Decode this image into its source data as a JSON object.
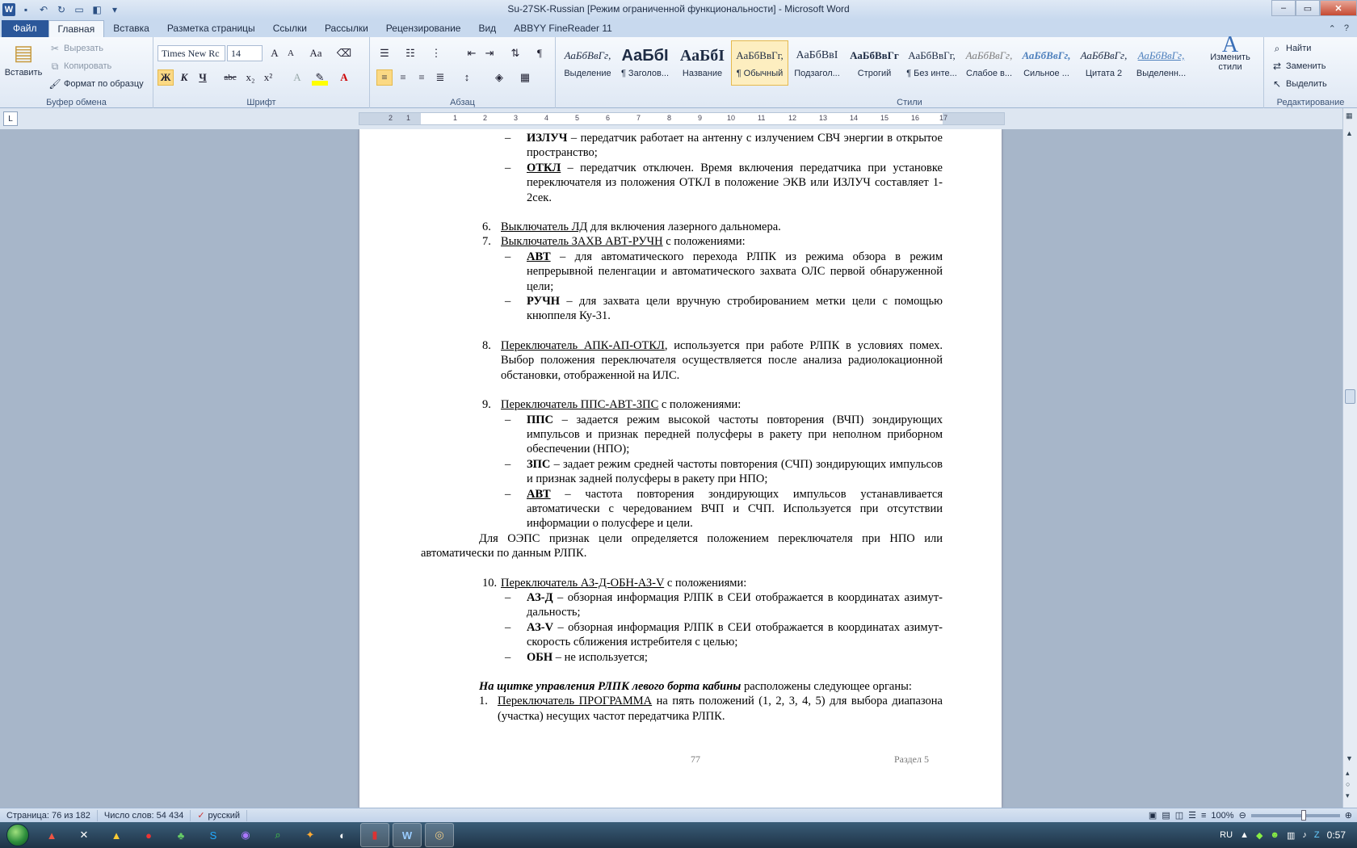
{
  "window": {
    "title": "Su-27SK-Russian [Режим ограниченной функциональности]  -  Microsoft Word"
  },
  "tabs": [
    {
      "label": "Файл"
    },
    {
      "label": "Главная"
    },
    {
      "label": "Вставка"
    },
    {
      "label": "Разметка страницы"
    },
    {
      "label": "Ссылки"
    },
    {
      "label": "Рассылки"
    },
    {
      "label": "Рецензирование"
    },
    {
      "label": "Вид"
    },
    {
      "label": "ABBYY FineReader 11"
    }
  ],
  "ribbon": {
    "clipboard": {
      "group": "Буфер обмена",
      "paste": "Вставить",
      "cut": "Вырезать",
      "copy": "Копировать",
      "format_painter": "Формат по образцу"
    },
    "font": {
      "group": "Шрифт",
      "font_name": "Times New Rc",
      "font_size": "14",
      "bold": "Ж",
      "italic": "К",
      "underline": "Ч",
      "strike": "abc",
      "sub": "x₂",
      "sup": "x²",
      "case": "Aa"
    },
    "paragraph": {
      "group": "Абзац"
    },
    "styles": {
      "group": "Стили",
      "change_styles": "Изменить стили",
      "items": [
        {
          "sample": "АаБбВвГг,",
          "name": "Выделение"
        },
        {
          "sample": "АаБбІ",
          "name": "¶ Заголов..."
        },
        {
          "sample": "АаБбІ",
          "name": "Название"
        },
        {
          "sample": "АаБбВвГг,",
          "name": "¶ Обычный"
        },
        {
          "sample": "АаБбВвІ",
          "name": "Подзагол..."
        },
        {
          "sample": "АаБбВвГг",
          "name": "Строгий"
        },
        {
          "sample": "АаБбВвГг,",
          "name": "¶ Без инте..."
        },
        {
          "sample": "АаБбВвГг,",
          "name": "Слабое в..."
        },
        {
          "sample": "АаБбВвГг,",
          "name": "Сильное ..."
        },
        {
          "sample": "АаБбВвГг,",
          "name": "Цитата 2"
        },
        {
          "sample": "АаБбВвГг,",
          "name": "Выделенн..."
        }
      ]
    },
    "editing": {
      "group": "Редактирование",
      "find": "Найти",
      "replace": "Заменить",
      "select": "Выделить"
    }
  },
  "document": {
    "p1_bold": "ИЗЛУЧ",
    "p1_text": " – передатчик работает на антенну с излучением СВЧ энергии в открытое пространство;",
    "p2_bold": "ОТКЛ",
    "p2_text": " – передатчик отключен. Время включения передатчика при установке переключателя из положения ОТКЛ в положение ЭКВ или ИЗЛУЧ составляет 1-2сек.",
    "i6_num": "6.",
    "i6_u": "Выключатель ЛД",
    "i6_text": " для включения лазерного дальномера.",
    "i7_num": "7.",
    "i7_u": "Выключатель ЗАХВ АВТ-РУЧН",
    "i7_text": " с положениями:",
    "i7a_bold": "АВТ",
    "i7a_text": " – для автоматического перехода РЛПК из режима обзора в режим непрерывной пеленгации и автоматического захвата ОЛС первой обнаруженной цели;",
    "i7b_bold": "РУЧН",
    "i7b_text": " – для захвата цели вручную стробированием метки цели с помощью кнюппеля Ку-31.",
    "i8_num": "8.",
    "i8_u": "Переключатель АПК-АП-ОТКЛ",
    "i8_text": ", используется при работе РЛПК в условиях помех. Выбор положения переключателя осуществляется после анализа радиолокационной обстановки, отображенной на ИЛС.",
    "i9_num": "9.",
    "i9_u": "Переключатель ППС-АВТ-ЗПС",
    "i9_text": " с положениями:",
    "i9a_bold": "ППС",
    "i9a_text": " – задается режим высокой частоты повторения (ВЧП) зондирующих импульсов и признак передней полусферы в ракету при неполном приборном обеспечении (НПО);",
    "i9b_bold": "ЗПС",
    "i9b_text": " – задает режим средней частоты повторения (СЧП) зондирующих импульсов и признак задней полусферы в ракету при НПО;",
    "i9c_bold": "АВТ",
    "i9c_text": " – частота повторения зондирующих импульсов устанавливается автоматически с чередованием ВЧП и СЧП. Используется при отсутствии информации о полусфере и цели.",
    "oeps_text": "Для ОЭПС признак цели определяется положением переключателя при НПО или автоматически по данным РЛПК.",
    "i10_num": "10.",
    "i10_u": "Переключатель АЗ-Д-ОБН-АЗ-V",
    "i10_text": " с положениями:",
    "i10a_bold": "АЗ-Д",
    "i10a_text": " – обзорная информация РЛПК в СЕИ отображается в координатах азимут-дальность;",
    "i10b_bold": "АЗ-V",
    "i10b_text": " – обзорная информация РЛПК в СЕИ отображается в координатах азимут-скорость сближения истребителя с целью;",
    "i10c_bold": "ОБН",
    "i10c_text": " – не используется;",
    "panel_bi": "На щитке управления РЛПК левого борта кабины",
    "panel_text": " расположены следующее органы:",
    "n1_num": "1.",
    "n1_u": "Переключатель ПРОГРАММА",
    "n1_text": " на пять положений (1, 2, 3, 4, 5) для выбора диапазона (участка) несущих частот передатчика РЛПК.",
    "page_number": "77",
    "section": "Раздел 5"
  },
  "status": {
    "page": "Страница: 76 из 182",
    "words": "Число слов: 54 434",
    "lang": "русский",
    "zoom": "100%"
  },
  "taskbar": {
    "lang": "RU",
    "time": "0:57"
  }
}
